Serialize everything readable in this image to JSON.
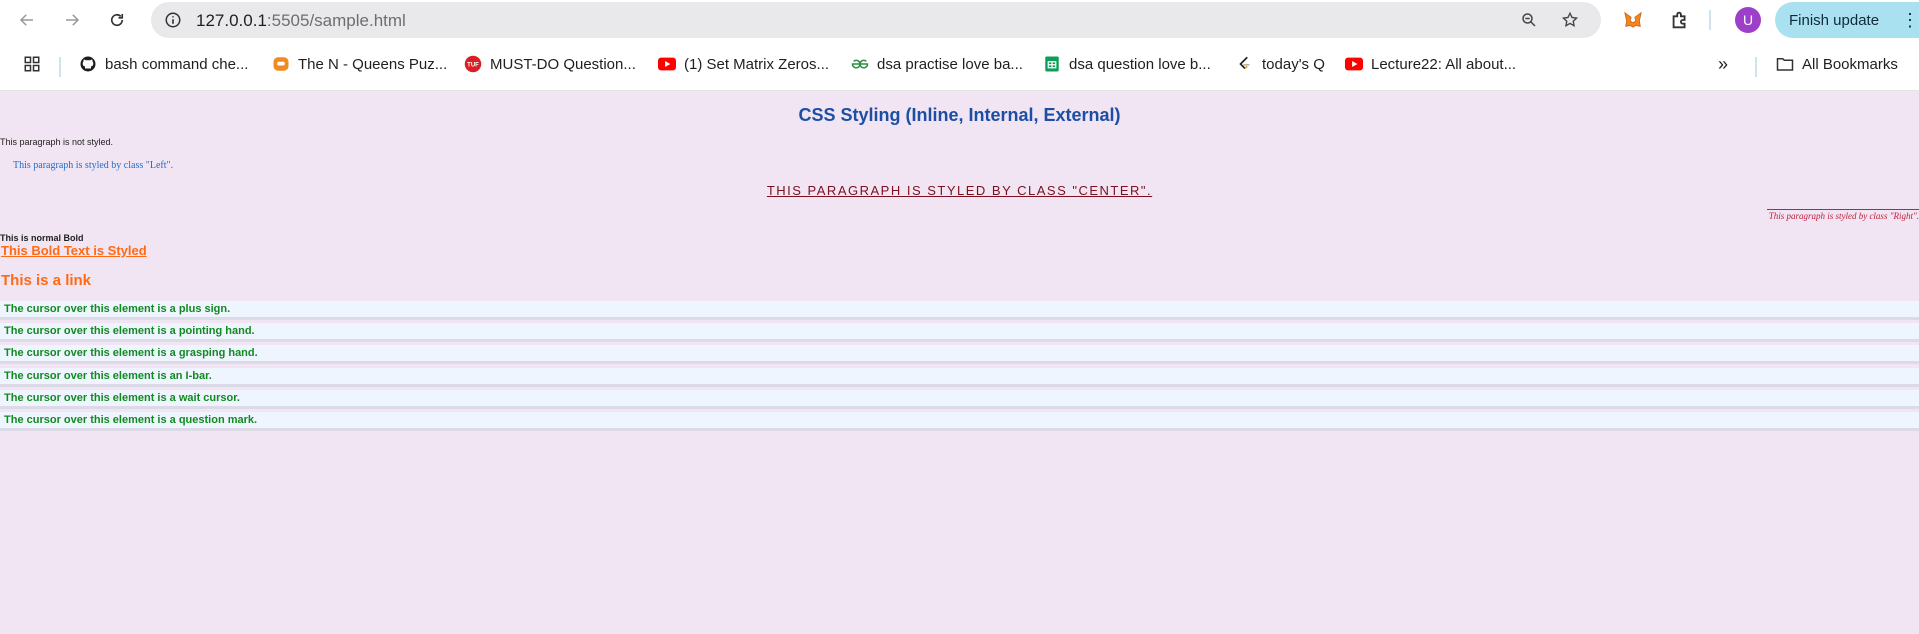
{
  "browser": {
    "url_host": "127.0.0.1",
    "url_path": ":5505/sample.html",
    "finish_update_label": "Finish update",
    "avatar_letter": "U",
    "bookmarks": [
      {
        "label": "bash command che...",
        "icon": "github-icon"
      },
      {
        "label": "The N - Queens Puz...",
        "icon": "codingninjas-icon"
      },
      {
        "label": "MUST-DO Question...",
        "icon": "tuf-icon"
      },
      {
        "label": "(1) Set Matrix Zeros...",
        "icon": "youtube-icon"
      },
      {
        "label": "dsa practise love ba...",
        "icon": "geeksforgeeks-icon"
      },
      {
        "label": "dsa question love b...",
        "icon": "google-sheets-icon"
      },
      {
        "label": "today's Q",
        "icon": "leetcode-icon"
      },
      {
        "label": "Lecture22: All about...",
        "icon": "youtube-icon"
      }
    ],
    "all_bookmarks_label": "All Bookmarks"
  },
  "page": {
    "title": "CSS Styling (Inline, Internal, External)",
    "plain_paragraph": "This paragraph is not styled.",
    "left_paragraph": "This paragraph is styled by class \"Left\".",
    "center_paragraph": "This paragraph is styled by class \"Center\".",
    "right_paragraph": "This paragraph is styled by class \"Right\".",
    "normal_bold": "This is normal Bold",
    "styled_bold": "This Bold Text is Styled",
    "link_text": "This is a link",
    "cursor_rows": [
      "The cursor over this element is a plus sign.",
      "The cursor over this element is a pointing hand.",
      "The cursor over this element is a grasping hand.",
      "The cursor over this element is an I-bar.",
      "The cursor over this element is a wait cursor.",
      "The cursor over this element is a question mark."
    ]
  },
  "colors": {
    "page_bg": "#f1e4f3",
    "title": "#1c4fa3",
    "accent_orange": "#ff6a13",
    "cursor_text": "#118a1f"
  }
}
